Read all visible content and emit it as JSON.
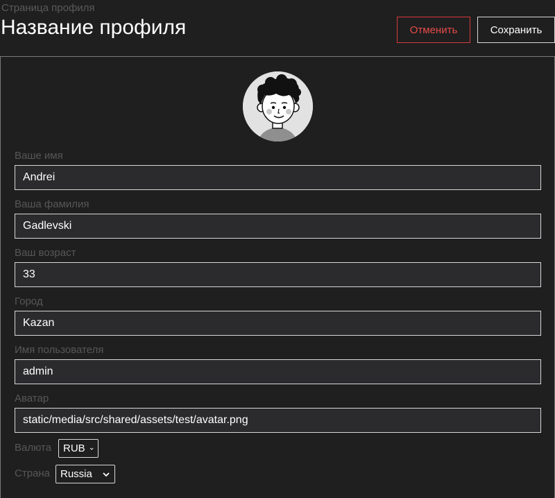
{
  "header": {
    "subtitle": "Страница профиля",
    "title": "Название профиля",
    "cancel_label": "Отменить",
    "save_label": "Сохранить"
  },
  "colors": {
    "background": "#1f1f1f",
    "input_background": "#2b2b2e",
    "cancel_accent": "#e84a4a",
    "label_muted": "#575757"
  },
  "avatar": {
    "icon": "user-avatar-icon"
  },
  "fields": [
    {
      "label": "Ваше имя",
      "value": "Andrei"
    },
    {
      "label": "Ваша фамилия",
      "value": "Gadlevski"
    },
    {
      "label": "Ваш возраст",
      "value": "33"
    },
    {
      "label": "Город",
      "value": "Kazan"
    },
    {
      "label": "Имя пользователя",
      "value": "admin"
    },
    {
      "label": "Аватар",
      "value": "static/media/src/shared/assets/test/avatar.png"
    }
  ],
  "currency": {
    "label": "Валюта",
    "selected": "RUB"
  },
  "country": {
    "label": "Страна",
    "selected": "Russia"
  }
}
